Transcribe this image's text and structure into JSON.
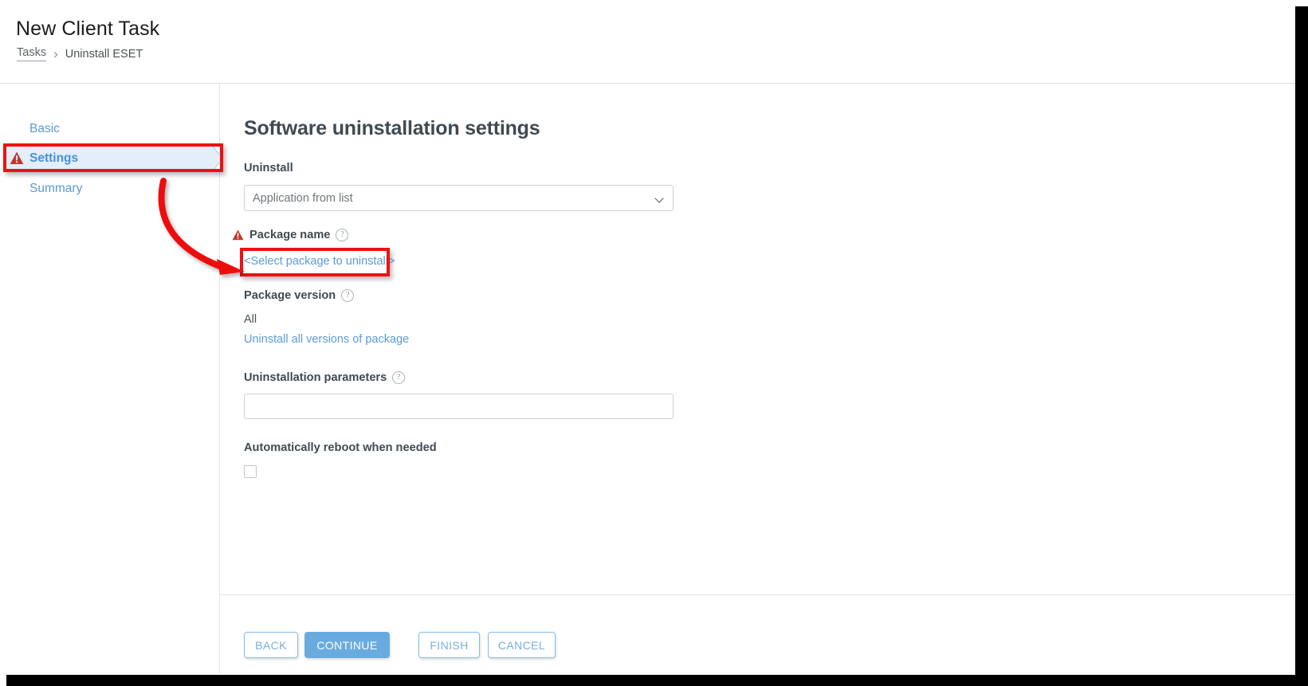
{
  "window": {
    "title": "New Client Task"
  },
  "breadcrumb": {
    "root": "Tasks",
    "separator": "›",
    "current": "Uninstall ESET"
  },
  "sidebar": {
    "items": [
      {
        "label": "Basic",
        "state": "inactive"
      },
      {
        "label": "Settings",
        "state": "active",
        "icon": "warning-triangle-icon"
      },
      {
        "label": "Summary",
        "state": "inactive"
      }
    ]
  },
  "main": {
    "section_title": "Software uninstallation settings",
    "fields": {
      "uninstall": {
        "label": "Uninstall",
        "value": "Application from list",
        "options": [
          "Application from list"
        ],
        "icon": "chevron-down-icon"
      },
      "package_name": {
        "label": "Package name",
        "warning_icon": "warning-triangle-icon",
        "help_icon": "question-mark-icon",
        "help_glyph": "?",
        "link_text": "<Select package to uninstall>"
      },
      "package_version": {
        "label": "Package version",
        "help_icon": "question-mark-icon",
        "help_glyph": "?",
        "value": "All",
        "link_text": "Uninstall all versions of package"
      },
      "uninstallation_parameters": {
        "label": "Uninstallation parameters",
        "help_icon": "question-mark-icon",
        "help_glyph": "?",
        "value": "",
        "placeholder": ""
      },
      "automatically_reboot": {
        "label": "Automatically reboot when needed",
        "checked": false
      }
    }
  },
  "footer": {
    "buttons": [
      {
        "label": "BACK",
        "style": "outline"
      },
      {
        "label": "CONTINUE",
        "style": "primary"
      },
      {
        "label": "FINISH",
        "style": "outline"
      },
      {
        "label": "CANCEL",
        "style": "outline"
      }
    ]
  },
  "annotations": {
    "highlight_color": "#ee1111",
    "boxes": [
      "settings-nav-item",
      "select-package-link"
    ],
    "arrow": "curved-arrow-from-settings-to-package-link"
  },
  "colors": {
    "accent_blue": "#5b9bd5",
    "primary_button": "#6aabdf",
    "active_nav_bg": "#e3eef9",
    "warning_red": "#c0392b",
    "annotation_red": "#ee1111",
    "heading_text": "#3f4a54"
  }
}
